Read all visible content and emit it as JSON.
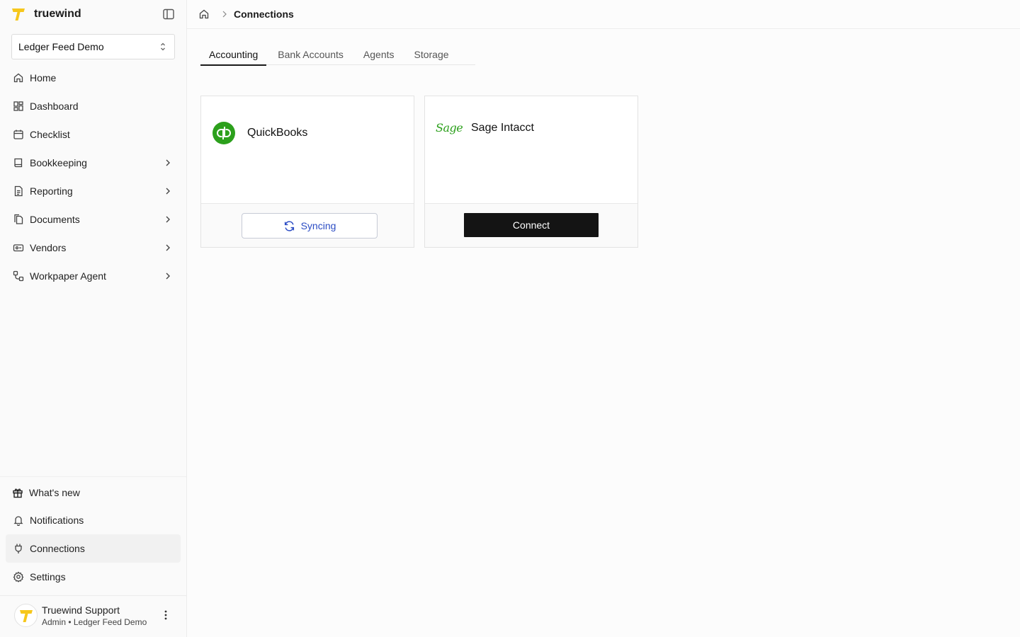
{
  "app": {
    "brand_name": "truewind",
    "brand_color": "#f6c71c"
  },
  "workspace": {
    "selected": "Ledger Feed Demo"
  },
  "sidebar": {
    "items": [
      {
        "label": "Home",
        "icon": "home-icon"
      },
      {
        "label": "Dashboard",
        "icon": "dashboard-icon"
      },
      {
        "label": "Checklist",
        "icon": "calendar-icon"
      },
      {
        "label": "Bookkeeping",
        "icon": "book-icon",
        "expandable": true
      },
      {
        "label": "Reporting",
        "icon": "file-text-icon",
        "expandable": true
      },
      {
        "label": "Documents",
        "icon": "documents-icon",
        "expandable": true
      },
      {
        "label": "Vendors",
        "icon": "vendor-icon",
        "expandable": true
      },
      {
        "label": "Workpaper Agent",
        "icon": "workflow-icon",
        "expandable": true
      }
    ],
    "bottom_items": [
      {
        "label": "What's new",
        "icon": "gift-icon"
      },
      {
        "label": "Notifications",
        "icon": "bell-icon"
      },
      {
        "label": "Connections",
        "icon": "plug-icon",
        "active": true
      },
      {
        "label": "Settings",
        "icon": "gear-icon"
      }
    ]
  },
  "user": {
    "name": "Truewind Support",
    "role": "Admin • Ledger Feed Demo"
  },
  "breadcrumb": {
    "current": "Connections"
  },
  "tabs": [
    {
      "label": "Accounting",
      "active": true
    },
    {
      "label": "Bank Accounts"
    },
    {
      "label": "Agents"
    },
    {
      "label": "Storage"
    }
  ],
  "cards": [
    {
      "title": "QuickBooks",
      "logo": "quickbooks-logo",
      "logo_color": "#2ca01c",
      "action": "Syncing",
      "action_color": "#2b4cc4"
    },
    {
      "title": "Sage Intacct",
      "logo_text": "Sage",
      "logo_color": "#2ca01c",
      "action": "Connect"
    }
  ]
}
